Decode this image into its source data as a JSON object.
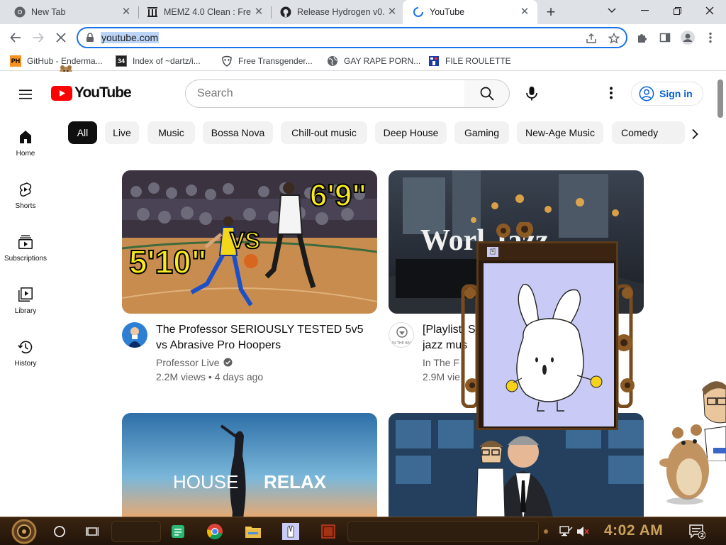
{
  "browser": {
    "tabs": [
      {
        "title": "New Tab",
        "icon": "chrome-icon"
      },
      {
        "title": "MEMZ 4.0 Clean : Fre",
        "icon": "archive-org-icon"
      },
      {
        "title": "Release Hydrogen v0.",
        "icon": "github-icon"
      },
      {
        "title": "YouTube",
        "icon": "loading-spinner-icon",
        "active": true
      }
    ],
    "address": {
      "url": "youtube.com"
    },
    "bookmarks": [
      {
        "label": "GitHub - Enderma...",
        "icon_text": "PH"
      },
      {
        "label": "Index of ~dartz/i...",
        "icon_text": "34"
      },
      {
        "label": "Free Transgender...",
        "icon_text": ""
      },
      {
        "label": "GAY RAPE PORN...",
        "icon_text": ""
      },
      {
        "label": "FILE ROULETTE",
        "icon_text": ""
      }
    ]
  },
  "youtube": {
    "logo_text": "YouTube",
    "search_placeholder": "Search",
    "signin_label": "Sign in",
    "guide": [
      {
        "label": "Home",
        "icon": "home-icon"
      },
      {
        "label": "Shorts",
        "icon": "shorts-icon"
      },
      {
        "label": "Subscriptions",
        "icon": "subscriptions-icon"
      },
      {
        "label": "Library",
        "icon": "library-icon"
      },
      {
        "label": "History",
        "icon": "history-icon"
      }
    ],
    "chips": [
      "All",
      "Live",
      "Music",
      "Bossa Nova",
      "Chill-out music",
      "Deep House",
      "Gaming",
      "New-Age Music",
      "Comedy"
    ],
    "videos": [
      {
        "title_line1": "The Professor SERIOUSLY TESTED 5v5",
        "title_line2": "vs Abrasive Pro Hoopers",
        "channel": "Professor Live",
        "views": "2.2M views",
        "age": "4 days ago",
        "overlay_left": "5'10\"",
        "overlay_mid": "VS",
        "overlay_right": "6'9\""
      },
      {
        "title_line1": "[Playlist] S",
        "title_line2": "jazz mus",
        "channel": "In The F",
        "views": "2.9M vie",
        "overlay_text": "Worl    Jazz",
        "avatar_text": "IN THE BAR"
      },
      {
        "overlay_left": "HOUSE",
        "overlay_right": "RELAX"
      },
      {}
    ]
  },
  "taskbar": {
    "clock": "4:02 AM",
    "notification_count": "2"
  },
  "colors": {
    "accent_blue": "#065fd4",
    "youtube_red": "#ff0000",
    "omnibox_border": "#1a73e8",
    "taskbar_brown": "#2a180b",
    "clock_gold": "#c8a25c"
  }
}
